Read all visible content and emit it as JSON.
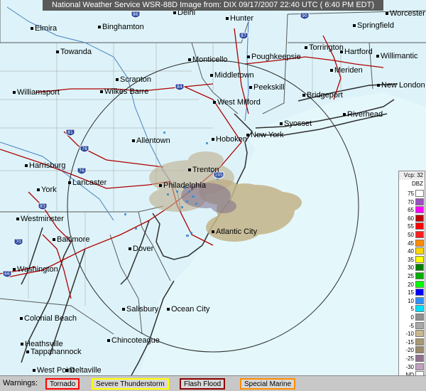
{
  "title": "National Weather Service WSR-88D Image from: DIX 09/17/2007 22:40 UTC ( 6:40 PM EDT)",
  "cities": [
    {
      "name": "Delhi"
    },
    {
      "name": "Hunter"
    },
    {
      "name": "Worcester"
    },
    {
      "name": "Elmira"
    },
    {
      "name": "Binghamton"
    },
    {
      "name": "Springfield"
    },
    {
      "name": "Towanda"
    },
    {
      "name": "Poughkeepsie"
    },
    {
      "name": "Torrington"
    },
    {
      "name": "Hartford"
    },
    {
      "name": "Willimantic"
    },
    {
      "name": "Monticello"
    },
    {
      "name": "Meriden"
    },
    {
      "name": "Middletown"
    },
    {
      "name": "Scranton"
    },
    {
      "name": "Peekskill"
    },
    {
      "name": "New London"
    },
    {
      "name": "Williamsport"
    },
    {
      "name": "Wilkes Barre"
    },
    {
      "name": "Bridgeport"
    },
    {
      "name": "West Milford"
    },
    {
      "name": "Riverhead"
    },
    {
      "name": "Syosset"
    },
    {
      "name": "New York"
    },
    {
      "name": "Hoboken"
    },
    {
      "name": "Allentown"
    },
    {
      "name": "Harrisburg"
    },
    {
      "name": "Trenton"
    },
    {
      "name": "Lancaster"
    },
    {
      "name": "Philadelphia"
    },
    {
      "name": "York"
    },
    {
      "name": "Westminster"
    },
    {
      "name": "Atlantic City"
    },
    {
      "name": "Baltimore"
    },
    {
      "name": "Dover"
    },
    {
      "name": "Washington"
    },
    {
      "name": "Salisbury"
    },
    {
      "name": "Ocean City"
    },
    {
      "name": "Colonial Beach"
    },
    {
      "name": "Chincoteague"
    },
    {
      "name": "Heathsville"
    },
    {
      "name": "Tappahannock"
    },
    {
      "name": "West Point"
    },
    {
      "name": "Deltaville"
    }
  ],
  "highway_shields": [
    {
      "label": "86"
    },
    {
      "label": "90"
    },
    {
      "label": "87"
    },
    {
      "label": "84"
    },
    {
      "label": "81"
    },
    {
      "label": "78"
    },
    {
      "label": "76"
    },
    {
      "label": "195"
    },
    {
      "label": "83"
    },
    {
      "label": "70"
    },
    {
      "label": "66"
    }
  ],
  "legend": {
    "head": "Vcp: 32",
    "unit": "DBZ",
    "rows": [
      {
        "label": "75",
        "color": "#ffffff"
      },
      {
        "label": "70",
        "color": "#9a50c0"
      },
      {
        "label": "65",
        "color": "#ff00ff"
      },
      {
        "label": "60",
        "color": "#c00000"
      },
      {
        "label": "55",
        "color": "#ff0000"
      },
      {
        "label": "50",
        "color": "#ff2020"
      },
      {
        "label": "45",
        "color": "#ff8c00"
      },
      {
        "label": "40",
        "color": "#ffd700"
      },
      {
        "label": "35",
        "color": "#ffff00"
      },
      {
        "label": "30",
        "color": "#008000"
      },
      {
        "label": "25",
        "color": "#00b000"
      },
      {
        "label": "20",
        "color": "#00ff00"
      },
      {
        "label": "15",
        "color": "#0000ff"
      },
      {
        "label": "10",
        "color": "#3090ff"
      },
      {
        "label": "5",
        "color": "#00e0ff"
      },
      {
        "label": "0",
        "color": "#909090"
      },
      {
        "label": "-5",
        "color": "#a8a8a8"
      },
      {
        "label": "-10",
        "color": "#c8b890"
      },
      {
        "label": "-15",
        "color": "#a89870"
      },
      {
        "label": "-20",
        "color": "#9a8a6a"
      },
      {
        "label": "-25",
        "color": "#907090"
      },
      {
        "label": "-30",
        "color": "#c0a0c0"
      },
      {
        "label": "ND",
        "color": "#ffffff"
      }
    ]
  },
  "warnings": {
    "label": "Warnings:",
    "items": [
      {
        "label": "Tornado",
        "color": "#ff0000"
      },
      {
        "label": "Severe Thunderstorm",
        "color": "#ffff00"
      },
      {
        "label": "Flash Flood",
        "color": "#8b0000"
      },
      {
        "label": "Special Marine",
        "color": "#ff8c00"
      }
    ]
  }
}
